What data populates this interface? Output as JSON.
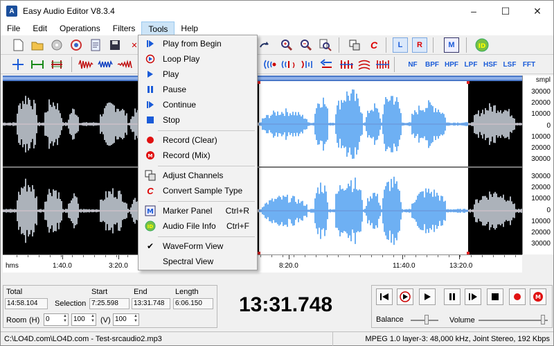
{
  "window": {
    "title": "Easy Audio Editor V8.3.4"
  },
  "menubar": {
    "items": [
      "File",
      "Edit",
      "Operations",
      "Filters",
      "Tools",
      "Help"
    ]
  },
  "toolbar2": {
    "filter_labels": [
      "NF",
      "BPF",
      "HPF",
      "LPF",
      "HSF",
      "LSF",
      "FFT"
    ],
    "channel_l": "L",
    "channel_r": "R",
    "marker": "M",
    "info": "ID"
  },
  "tools_menu": {
    "items": [
      {
        "label": "Play from Begin",
        "icon": "play-from-begin-icon",
        "shortcut": ""
      },
      {
        "label": "Loop Play",
        "icon": "loop-play-icon",
        "shortcut": ""
      },
      {
        "label": "Play",
        "icon": "play-icon",
        "shortcut": ""
      },
      {
        "label": "Pause",
        "icon": "pause-icon",
        "shortcut": ""
      },
      {
        "label": "Continue",
        "icon": "continue-icon",
        "shortcut": ""
      },
      {
        "label": "Stop",
        "icon": "stop-icon",
        "shortcut": ""
      },
      {
        "label": "Record (Clear)",
        "icon": "record-icon",
        "shortcut": ""
      },
      {
        "label": "Record (Mix)",
        "icon": "record-mix-icon",
        "shortcut": ""
      },
      {
        "label": "Adjust Channels",
        "icon": "adjust-channels-icon",
        "shortcut": ""
      },
      {
        "label": "Convert  Sample Type",
        "icon": "convert-icon",
        "shortcut": ""
      },
      {
        "label": "Marker Panel",
        "icon": "marker-panel-icon",
        "shortcut": "Ctrl+R"
      },
      {
        "label": "Audio File Info",
        "icon": "audio-info-icon",
        "shortcut": "Ctrl+F"
      },
      {
        "label": "WaveForm View",
        "icon": "check-icon",
        "shortcut": ""
      },
      {
        "label": "Spectral View",
        "icon": "",
        "shortcut": ""
      }
    ]
  },
  "scale": {
    "unit": "smpl",
    "labels": [
      "30000",
      "20000",
      "10000",
      "0",
      "10000",
      "20000",
      "30000",
      "30000",
      "20000",
      "10000",
      "0",
      "10000",
      "20000",
      "30000"
    ]
  },
  "ruler": {
    "unit": "hms",
    "ticks": [
      "1:40.0",
      "3:20.0",
      "8:20.0",
      "11:40.0",
      "13:20.0"
    ]
  },
  "selection": {
    "total_label": "Total",
    "total_value": "14:58.104",
    "selection_label": "Selection",
    "start_label": "Start",
    "start_value": "7:25.598",
    "end_label": "End",
    "end_value": "13:31.748",
    "length_label": "Length",
    "length_value": "6:06.150"
  },
  "room": {
    "label": "Room",
    "h_label": "(H)",
    "v_label": "(V)",
    "h1": "0",
    "h2": "100",
    "v": "100"
  },
  "position": "13:31.748",
  "transport": {
    "balance_label": "Balance",
    "volume_label": "Volume"
  },
  "status": {
    "path": "C:\\LO4D.com\\LO4D.com - Test-srcaudio2.mp3",
    "format": "MPEG 1.0 layer-3: 48,000 kHz, Joint Stereo, 192 Kbps"
  },
  "colors": {
    "wave": "#4a9cf0",
    "wave_dim": "#d8e0ea",
    "bg": "#000000",
    "selection": "#ffffff",
    "accent": "#1a5bd8"
  }
}
